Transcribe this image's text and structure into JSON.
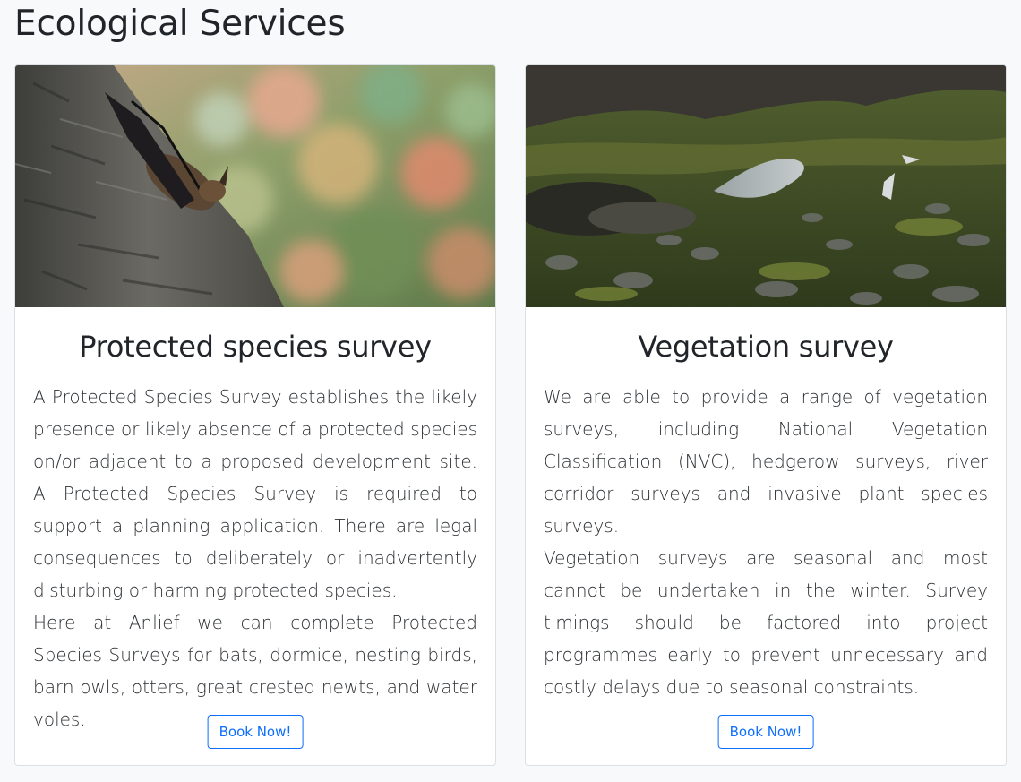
{
  "page": {
    "title": "Ecological Services"
  },
  "cards": [
    {
      "image": "bat-on-tree-photo",
      "title": "Protected species survey",
      "paragraphs": [
        "A Protected Species Survey establishes the likely presence or likely absence of a protected species on/or adjacent to a proposed development site. A Protected Species Survey is required to support a planning application. There are legal consequences to deliberately or inadvertently disturbing or harming protected species.",
        "Here at Anlief we can complete Protected Species Surveys for bats, dormice, nesting birds, barn owls, otters, great crested newts, and water voles."
      ],
      "button_label": "Book Now!"
    },
    {
      "image": "upland-moorland-pool-photo",
      "title": "Vegetation survey",
      "paragraphs": [
        "We are able to provide a range of vegetation surveys, including National Vegetation Classification (NVC), hedgerow surveys, river corridor surveys and invasive plant species surveys.",
        "Vegetation surveys are seasonal and most cannot be undertaken in the winter. Survey timings should be factored into project programmes early to prevent unnecessary and costly delays due to seasonal constraints."
      ],
      "button_label": "Book Now!"
    }
  ],
  "colors": {
    "accent": "#0d6efd",
    "background": "#f8f9fa",
    "card_border": "#dcdfe3",
    "text": "#212529"
  }
}
